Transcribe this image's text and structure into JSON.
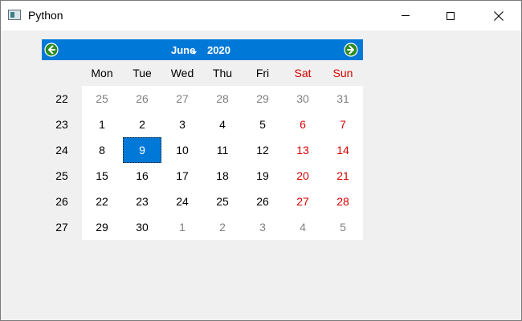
{
  "window": {
    "title": "Python",
    "icons": {
      "app": "app-window-icon",
      "minimize": "minimize-icon",
      "maximize": "maximize-icon",
      "close": "close-icon"
    }
  },
  "calendar": {
    "month": "June",
    "year": "2020",
    "prev_icon": "arrow-left-icon",
    "next_icon": "arrow-right-icon",
    "accent_color": "#0078d7",
    "weekend_color": "#d90000",
    "day_headers": [
      "Mon",
      "Tue",
      "Wed",
      "Thu",
      "Fri",
      "Sat",
      "Sun"
    ],
    "week_numbers": [
      "22",
      "23",
      "24",
      "25",
      "26",
      "27"
    ],
    "weeks": [
      [
        {
          "d": "25",
          "o": true
        },
        {
          "d": "26",
          "o": true
        },
        {
          "d": "27",
          "o": true
        },
        {
          "d": "28",
          "o": true
        },
        {
          "d": "29",
          "o": true
        },
        {
          "d": "30",
          "o": true
        },
        {
          "d": "31",
          "o": true
        }
      ],
      [
        {
          "d": "1"
        },
        {
          "d": "2"
        },
        {
          "d": "3"
        },
        {
          "d": "4"
        },
        {
          "d": "5"
        },
        {
          "d": "6"
        },
        {
          "d": "7"
        }
      ],
      [
        {
          "d": "8"
        },
        {
          "d": "9",
          "sel": true
        },
        {
          "d": "10"
        },
        {
          "d": "11"
        },
        {
          "d": "12"
        },
        {
          "d": "13"
        },
        {
          "d": "14"
        }
      ],
      [
        {
          "d": "15"
        },
        {
          "d": "16"
        },
        {
          "d": "17"
        },
        {
          "d": "18"
        },
        {
          "d": "19"
        },
        {
          "d": "20"
        },
        {
          "d": "21"
        }
      ],
      [
        {
          "d": "22"
        },
        {
          "d": "23"
        },
        {
          "d": "24"
        },
        {
          "d": "25"
        },
        {
          "d": "26"
        },
        {
          "d": "27"
        },
        {
          "d": "28"
        }
      ],
      [
        {
          "d": "29"
        },
        {
          "d": "30"
        },
        {
          "d": "1",
          "o": true
        },
        {
          "d": "2",
          "o": true
        },
        {
          "d": "3",
          "o": true
        },
        {
          "d": "4",
          "o": true
        },
        {
          "d": "5",
          "o": true
        }
      ]
    ]
  }
}
